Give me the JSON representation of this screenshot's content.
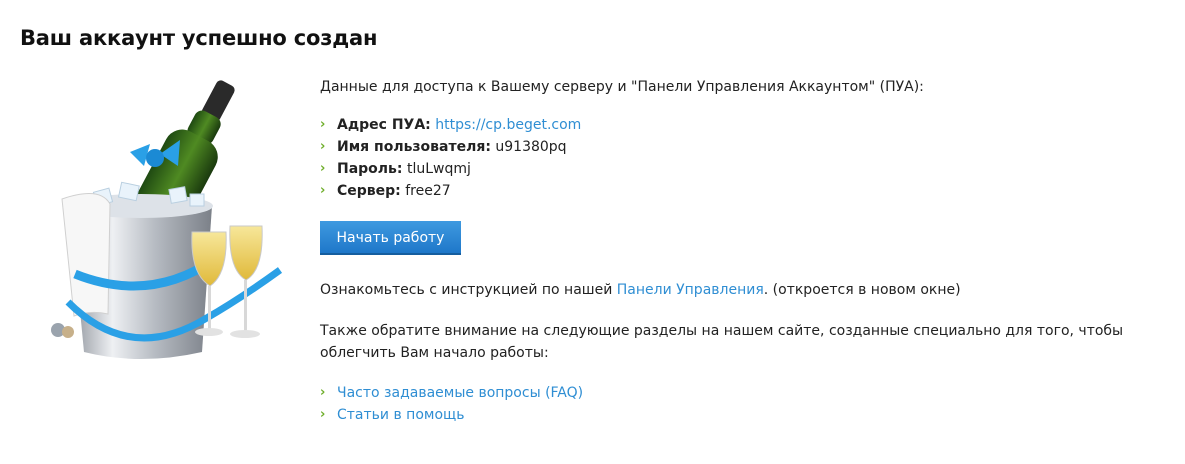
{
  "page": {
    "title": "Ваш аккаунт успешно создан"
  },
  "illustration": {
    "icon": "champagne-bucket-icon"
  },
  "intro_text": "Данные для доступа к Вашему серверу и \"Панели Управления Аккаунтом\" (ПУА):",
  "credentials": [
    {
      "label": "Адрес ПУА:",
      "value": "https://cp.beget.com",
      "is_link": true
    },
    {
      "label": "Имя пользователя:",
      "value": "u91380pq",
      "is_link": false
    },
    {
      "label": "Пароль:",
      "value": "tluLwqmj",
      "is_link": false
    },
    {
      "label": "Сервер:",
      "value": "free27",
      "is_link": false
    }
  ],
  "start_button": {
    "label": "Начать работу"
  },
  "instructions": {
    "before": "Ознакомьтесь с инструкцией по нашей ",
    "link": "Панели Управления",
    "after": ". (откроется в новом окне)"
  },
  "sections_text": "Также обратите внимание на следующие разделы на нашем сайте, созданные специально для того, чтобы облегчить Вам начало работы:",
  "help_links": [
    {
      "label": "Часто задаваемые вопросы (FAQ)"
    },
    {
      "label": "Статьи в помощь"
    }
  ],
  "colors": {
    "accent": "#2f8ed3",
    "chevron": "#6fae2b",
    "button": "#1e77c9"
  }
}
